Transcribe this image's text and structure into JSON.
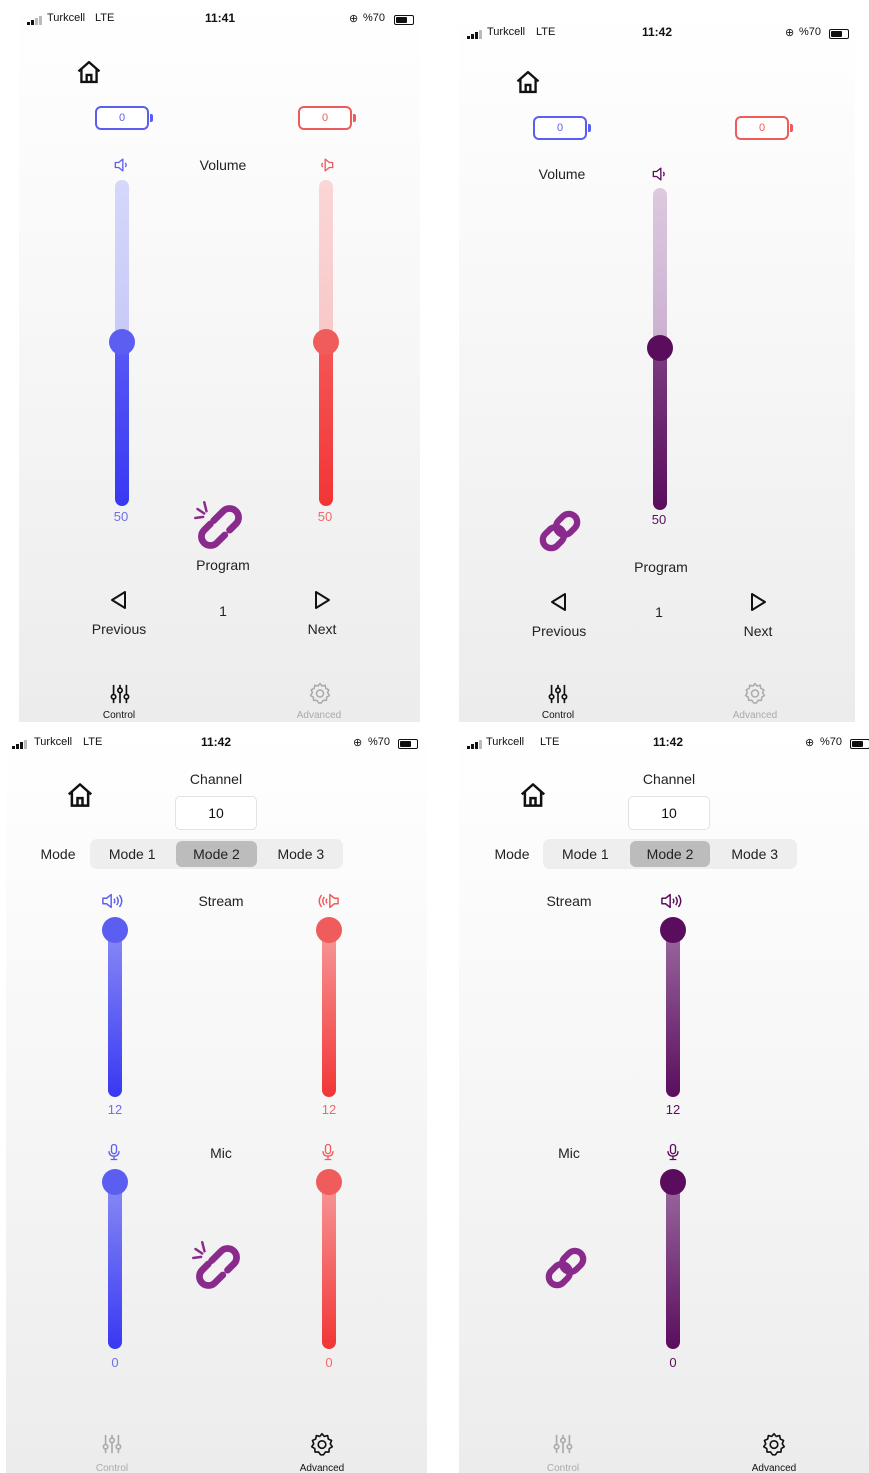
{
  "colors": {
    "left": "#4b4cf2",
    "right": "#f24747",
    "linked": "#5a0d5d",
    "link_icon": "#8a2a8c"
  },
  "screens": [
    {
      "status": {
        "carrier": "Turkcell",
        "network": "LTE",
        "time": "11:41",
        "battery": "%70"
      },
      "battery_left": "0",
      "battery_right": "0",
      "volume_label": "Volume",
      "volume_left_value": "50",
      "volume_right_value": "50",
      "volume_level": 0.5,
      "link_state": "unlinked",
      "program_label": "Program",
      "program_value": "1",
      "previous_label": "Previous",
      "next_label": "Next",
      "tab_control": "Control",
      "tab_advanced": "Advanced",
      "active_tab": "Control"
    },
    {
      "status": {
        "carrier": "Turkcell",
        "network": "LTE",
        "time": "11:42",
        "battery": "%70"
      },
      "battery_left": "0",
      "battery_right": "0",
      "volume_label": "Volume",
      "volume_value": "50",
      "volume_level": 0.5,
      "link_state": "linked",
      "program_label": "Program",
      "program_value": "1",
      "previous_label": "Previous",
      "next_label": "Next",
      "tab_control": "Control",
      "tab_advanced": "Advanced",
      "active_tab": "Control"
    },
    {
      "status": {
        "carrier": "Turkcell",
        "network": "LTE",
        "time": "11:42",
        "battery": "%70"
      },
      "channel_label": "Channel",
      "channel_value": "10",
      "mode_label": "Mode",
      "modes": [
        "Mode 1",
        "Mode 2",
        "Mode 3"
      ],
      "selected_mode": "Mode 2",
      "stream_label": "Stream",
      "stream_left_value": "12",
      "stream_right_value": "12",
      "mic_label": "Mic",
      "mic_left_value": "0",
      "mic_right_value": "0",
      "link_state": "unlinked",
      "tab_control": "Control",
      "tab_advanced": "Advanced",
      "active_tab": "Advanced"
    },
    {
      "status": {
        "carrier": "Turkcell",
        "network": "LTE",
        "time": "11:42",
        "battery": "%70"
      },
      "channel_label": "Channel",
      "channel_value": "10",
      "mode_label": "Mode",
      "modes": [
        "Mode 1",
        "Mode 2",
        "Mode 3"
      ],
      "selected_mode": "Mode 2",
      "stream_label": "Stream",
      "stream_value": "12",
      "mic_label": "Mic",
      "mic_value": "0",
      "link_state": "linked",
      "tab_control": "Control",
      "tab_advanced": "Advanced",
      "active_tab": "Advanced"
    }
  ]
}
